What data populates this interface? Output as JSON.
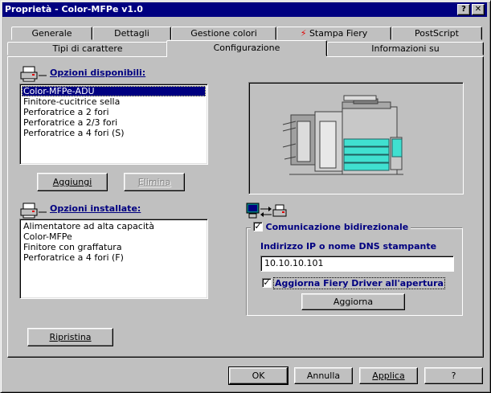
{
  "window": {
    "title": "Proprietà - Color-MFPe v1.0",
    "help_button": "?",
    "close_button": "✕"
  },
  "tabs_row1": [
    "Generale",
    "Dettagli",
    "Gestione colori",
    "Stampa Fiery",
    "PostScript"
  ],
  "tabs_row2": [
    "Tipi di carattere",
    "Configurazione",
    "Informazioni su"
  ],
  "active_tab": "Configurazione",
  "available": {
    "label": "Opzioni disponibili:",
    "items": [
      "Color-MFPe-ADU",
      "Finitore-cucitrice sella",
      "Perforatrice a 2 fori",
      "Perforatrice a 2/3 fori",
      "Perforatrice a 4 fori (S)"
    ],
    "selected_index": 0,
    "add_button": "Aggiungi",
    "remove_button": "Elimina"
  },
  "installed": {
    "label": "Opzioni installate:",
    "items": [
      "Alimentatore ad alta capacità",
      "Color-MFPe",
      "Finitore con graffatura",
      "Perforatrice a 4 fori (F)"
    ]
  },
  "reset_button": "Ripristina",
  "bidirectional": {
    "checkbox_label": "Comunicazione bidirezionale",
    "checked": true,
    "ip_label": "Indirizzo IP o nome DNS stampante",
    "ip_value": "10.10.10.101",
    "update_driver_label": "Aggiorna Fiery Driver all'apertura",
    "update_driver_checked": true,
    "update_button": "Aggiorna"
  },
  "footer": {
    "ok": "OK",
    "cancel": "Annulla",
    "apply": "Applica",
    "help": "?"
  },
  "colors": {
    "titlebar": "#000080",
    "face": "#c0c0c0",
    "selection": "#000080",
    "printer_accent": "#40e0d0"
  }
}
